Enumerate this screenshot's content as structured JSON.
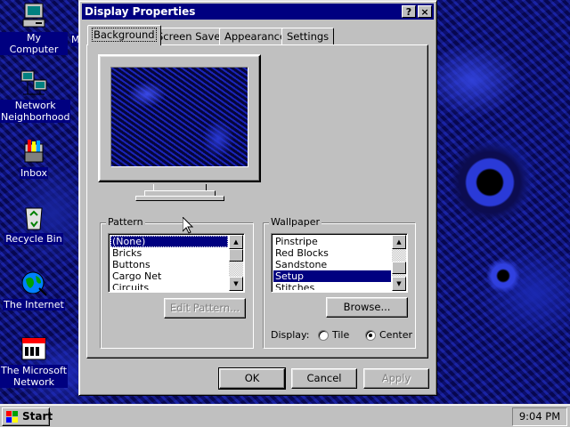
{
  "desktop": {
    "icons": [
      {
        "label": "My Computer",
        "icon": "computer-icon"
      },
      {
        "label": "Network Neighborhood",
        "icon": "network-icon"
      },
      {
        "label": "Inbox",
        "icon": "inbox-icon"
      },
      {
        "label": "Recycle Bin",
        "icon": "recycle-bin-icon"
      },
      {
        "label": "The Internet",
        "icon": "internet-icon"
      },
      {
        "label": "The Microsoft Network",
        "icon": "msn-icon"
      }
    ],
    "partial_icon_label": "M"
  },
  "dialog": {
    "title": "Display Properties",
    "help_button": "?",
    "close_button": "×",
    "tabs": [
      {
        "label": "Background",
        "active": true
      },
      {
        "label": "Screen Saver",
        "active": false
      },
      {
        "label": "Appearance",
        "active": false
      },
      {
        "label": "Settings",
        "active": false
      }
    ],
    "pattern": {
      "title": "Pattern",
      "items": [
        "(None)",
        "Bricks",
        "Buttons",
        "Cargo Net",
        "Circuits"
      ],
      "selected": "(None)",
      "edit_button": "Edit Pattern..."
    },
    "wallpaper": {
      "title": "Wallpaper",
      "items": [
        "Pinstripe",
        "Red Blocks",
        "Sandstone",
        "Setup",
        "Stitches"
      ],
      "selected": "Setup",
      "browse_button": "Browse...",
      "display_label": "Display:",
      "options": [
        {
          "label": "Tile",
          "checked": false
        },
        {
          "label": "Center",
          "checked": true
        }
      ]
    },
    "buttons": {
      "ok": "OK",
      "cancel": "Cancel",
      "apply": "Apply"
    }
  },
  "taskbar": {
    "start_label": "Start",
    "clock": "9:04 PM"
  },
  "colors": {
    "window_face": "#c0c0c0",
    "title_bar": "#000080",
    "selection": "#000080",
    "desktop": "#101070"
  }
}
